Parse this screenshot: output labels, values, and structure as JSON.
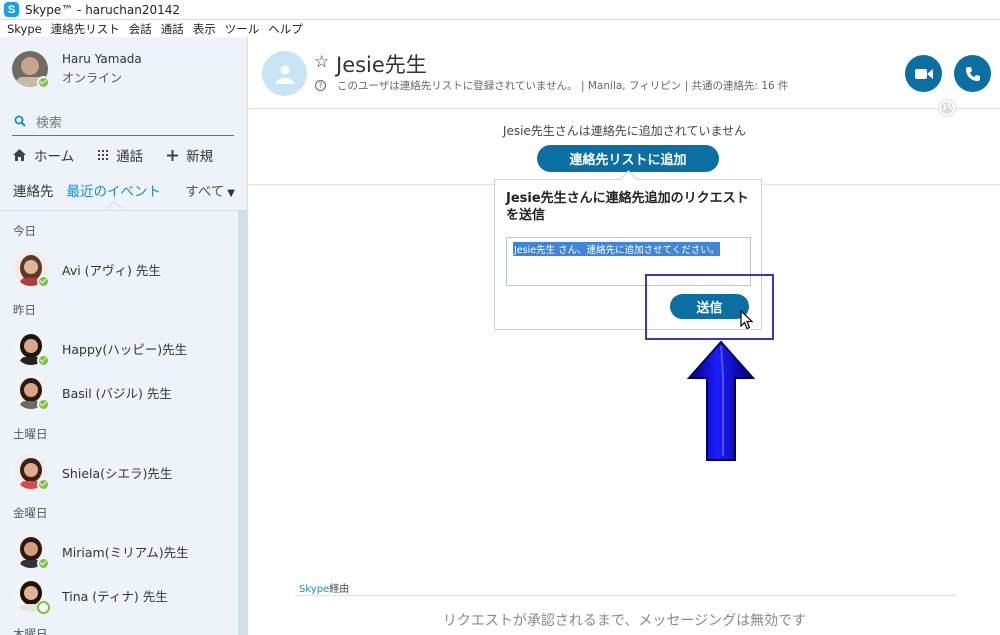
{
  "window": {
    "title": "Skype™ - haruchan20142"
  },
  "menu": [
    "Skype",
    "連絡先リスト",
    "会話",
    "通話",
    "表示",
    "ツール",
    "ヘルプ"
  ],
  "profile": {
    "name": "Haru Yamada",
    "status": "オンライン"
  },
  "search": {
    "placeholder": "検索"
  },
  "nav": {
    "home": "ホーム",
    "calls": "通話",
    "new": "新規"
  },
  "tabs": {
    "contacts": "連絡先",
    "recent": "最近のイベント",
    "all": "すべて"
  },
  "recent": [
    {
      "day": "今日",
      "contacts": [
        {
          "name": "Avi (アヴィ) 先生",
          "online": true
        }
      ]
    },
    {
      "day": "昨日",
      "contacts": [
        {
          "name": "Happy(ハッピー)先生",
          "online": true
        },
        {
          "name": "Basil (バジル) 先生",
          "online": true
        }
      ]
    },
    {
      "day": "土曜日",
      "contacts": [
        {
          "name": "Shiela(シエラ)先生",
          "online": true
        }
      ]
    },
    {
      "day": "金曜日",
      "contacts": [
        {
          "name": "Miriam(ミリアム)先生",
          "online": true
        },
        {
          "name": "Tina (ティナ) 先生",
          "online": false
        }
      ]
    },
    {
      "day": "木曜日",
      "contacts": []
    }
  ],
  "conversation": {
    "contact_name": "Jesie先生",
    "info": "このユーザは連絡先リストに登録されていません。 | Manila, フィリピン | 共通の連絡先: 16 件",
    "notice": "Jesie先生さんは連絡先に追加されていません",
    "add_button": "連絡先リストに追加",
    "popup": {
      "title": "Jesie先生さんに連絡先追加のリクエストを送信",
      "message": "Jesie先生 さん、連絡先に追加させてください。",
      "send_button": "送信"
    },
    "via_prefix": "Skype",
    "via_suffix": "経由",
    "disabled_message": "リクエストが承認されるまで、メッセージングは無効です"
  },
  "colors": {
    "accent": "#0b6fa4",
    "online": "#7dc242",
    "highlight": "#3838c8",
    "arrow": "#0a0ad6"
  },
  "icons": [
    "skype-logo-icon",
    "search-icon",
    "home-icon",
    "dialpad-icon",
    "plus-icon",
    "chevron-down-icon",
    "star-icon",
    "question-icon",
    "video-icon",
    "phone-icon",
    "globe-icon",
    "cursor-icon",
    "up-arrow-icon"
  ]
}
